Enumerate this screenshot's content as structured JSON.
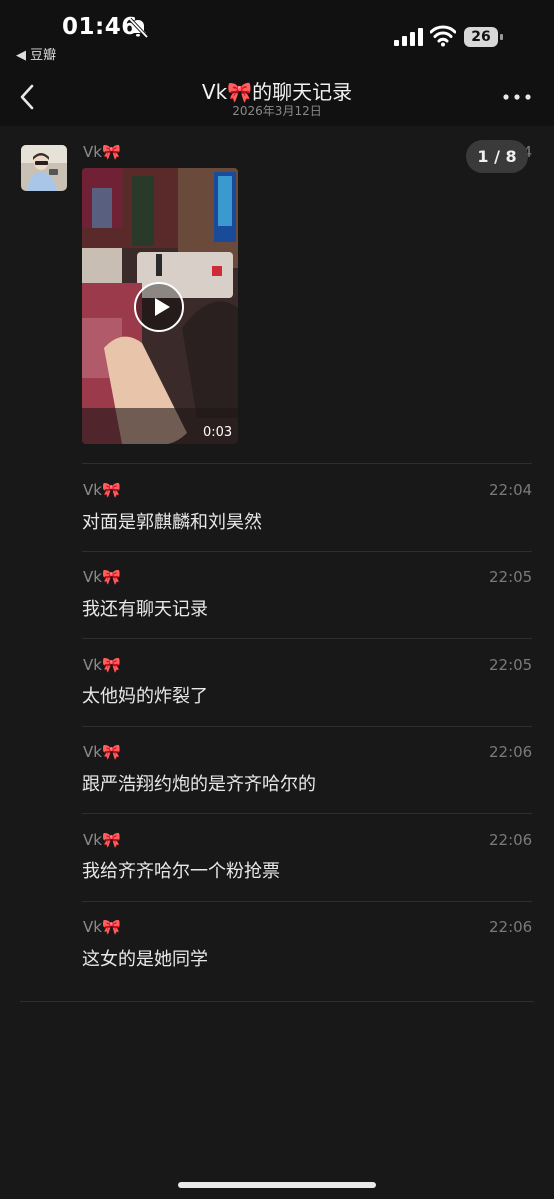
{
  "status_bar": {
    "time": "01:46",
    "back_app": "◀ 豆瓣",
    "battery": "26"
  },
  "nav": {
    "title": "Vk🎀的聊天记录",
    "subtitle": "2026年3月12日"
  },
  "video_message": {
    "sender": "Vk🎀",
    "time": "22:04",
    "counter": "1 / 8",
    "duration": "0:03"
  },
  "messages": [
    {
      "sender": "Vk🎀",
      "time": "22:04",
      "text": "对面是郭麒麟和刘昊然"
    },
    {
      "sender": "Vk🎀",
      "time": "22:05",
      "text": "我还有聊天记录"
    },
    {
      "sender": "Vk🎀",
      "time": "22:05",
      "text": "太他妈的炸裂了"
    },
    {
      "sender": "Vk🎀",
      "time": "22:06",
      "text": "跟严浩翔约炮的是齐齐哈尔的"
    },
    {
      "sender": "Vk🎀",
      "time": "22:06",
      "text": "我给齐齐哈尔一个粉抢票"
    },
    {
      "sender": "Vk🎀",
      "time": "22:06",
      "text": "这女的是她同学"
    }
  ],
  "icons": {
    "back": "chevron-left-icon",
    "more": "more-dots-icon",
    "play": "play-icon",
    "bell_muted": "bell-slash-icon",
    "signal": "signal-icon",
    "wifi": "wifi-icon"
  },
  "colors": {
    "background": "#181818",
    "bar": "#111111",
    "bow": "#ff7fb3"
  }
}
